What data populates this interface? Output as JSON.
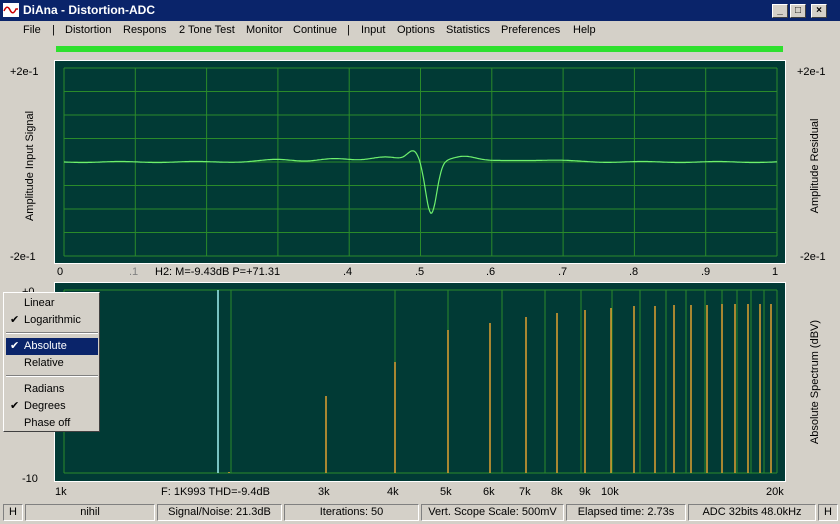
{
  "window": {
    "title": "DiAna - Distortion-ADC",
    "min_label": "_",
    "max_label": "□",
    "close_label": "×"
  },
  "menu": [
    "File",
    "|",
    "Distortion",
    "Respons",
    "2 Tone Test",
    "Monitor",
    "Continue",
    "|",
    "Input",
    "Options",
    "Statistics",
    "Preferences",
    "Help"
  ],
  "colors": {
    "plot_bg": "#013a35",
    "grid": "#2a8a2a",
    "trace": "#6ef06e",
    "bar_fundamental": "#a0f0f0",
    "bar_harmonic": "#e0a030",
    "level_bar": "#2ee02e"
  },
  "scope": {
    "ytop_left": "+2e-1",
    "ybot_left": "-2e-1",
    "ytop_right": "+2e-1",
    "ybot_right": "-2e-1",
    "left_label": "Amplitude Input Signal",
    "right_label": "Amplitude Residual",
    "xticks": [
      "0",
      ".1",
      ".4",
      ".5",
      ".6",
      ".7",
      ".8",
      ".9",
      "1"
    ],
    "info": "H2: M=-9.43dB P=+71.31"
  },
  "spectrum": {
    "ytop_left": "+0",
    "ybot_left": "-10",
    "right_label": "Absolute Spectrum (dBV)",
    "xticks": [
      "1k",
      "3k",
      "4k",
      "5k",
      "6k",
      "7k",
      "8k",
      "9k",
      "10k",
      "20k"
    ],
    "info": "F: 1K993 THD=-9.4dB"
  },
  "popup_menu": [
    {
      "label": "Linear",
      "checked": false,
      "selected": false
    },
    {
      "label": "Logarithmic",
      "checked": true,
      "selected": false
    },
    {
      "label": "Absolute",
      "checked": true,
      "selected": true
    },
    {
      "label": "Relative",
      "checked": false,
      "selected": false
    },
    {
      "label": "Radians",
      "checked": false,
      "selected": false
    },
    {
      "label": "Degrees",
      "checked": true,
      "selected": false
    },
    {
      "label": "Phase off",
      "checked": false,
      "selected": false
    }
  ],
  "status": {
    "left_h": "H",
    "name": "nihil",
    "snr": "Signal/Noise:   21.3dB",
    "iterations": "Iterations: 50",
    "scope_scale": "Vert. Scope Scale: 500mV",
    "elapsed": "Elapsed time: 2.73s",
    "adc": "ADC 32bits 48.0kHz",
    "right_h": "H"
  }
}
